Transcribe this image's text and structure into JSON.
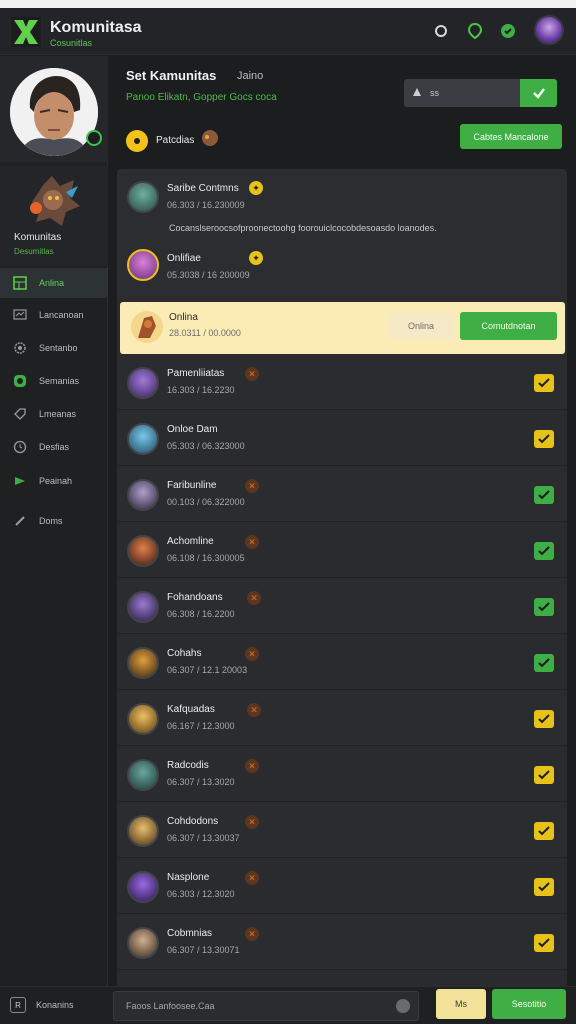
{
  "app": {
    "name": "Komunitasa",
    "subtitle": "Cosunitlas"
  },
  "community": {
    "name": "Komunitas",
    "subtitle": "Desumitlas"
  },
  "sidebar": {
    "items": [
      {
        "label": "Anlina",
        "icon": "grid-icon",
        "active": true
      },
      {
        "label": "Lancanoan",
        "icon": "monitor-icon",
        "active": false
      },
      {
        "label": "Sentanbo",
        "icon": "gear-icon",
        "active": false
      },
      {
        "label": "Semanias",
        "icon": "discord-icon",
        "active": false
      },
      {
        "label": "Lmeanas",
        "icon": "tag-icon",
        "active": false
      },
      {
        "label": "Desfias",
        "icon": "clock-icon",
        "active": false
      },
      {
        "label": "Peainah",
        "icon": "play-icon",
        "active": false
      },
      {
        "label": "Doms",
        "icon": "pencil-icon",
        "active": false
      }
    ]
  },
  "header": {
    "title": "Set Kamunitas",
    "tag": "Jaino",
    "subtitle": "Panoo Elikatn, Gopper Gocs coca",
    "search_placeholder": "ss",
    "filter_label": "Patcdias",
    "manage_label": "Cabtes Mancalone"
  },
  "panel": {
    "pinned": [
      {
        "name": "Saribe Contmns",
        "time": "06.303 / 16.230009"
      },
      {
        "name": "Onlifiae",
        "time": "05.3038 / 16 200009"
      }
    ],
    "description": "Cocanslseroocsofproonectoohg foorouiclcocobdesoasdo loanodes."
  },
  "highlight": {
    "name": "Onlina",
    "time": "28.0311 / 00.0000",
    "online_label": "Onlina",
    "button_label": "Comutdnotan"
  },
  "members": [
    {
      "name": "Pamenliiatas",
      "time": "16.303 / 16.2230"
    },
    {
      "name": "Onloe Dam",
      "time": "05.303 / 06.323000"
    },
    {
      "name": "Faribunline",
      "time": "00.103 / 06.322000"
    },
    {
      "name": "Achomline",
      "time": "06.108 / 16.300005"
    },
    {
      "name": "Fohandoans",
      "time": "06.308 / 16.2200"
    },
    {
      "name": "Cohahs",
      "time": "06.307 / 12.1 20003"
    },
    {
      "name": "Kafquadas",
      "time": "06.167 / 12.3000"
    },
    {
      "name": "Radcodis",
      "time": "06.307 / 13.3020"
    },
    {
      "name": "Cohdodons",
      "time": "06.307 / 13.30037"
    },
    {
      "name": "Nasplone",
      "time": "06.303 / 12.3020"
    },
    {
      "name": "Cobmnias",
      "time": "06.307 / 13.30071"
    }
  ],
  "footer": {
    "left_label": "Konanins",
    "input_placeholder": "Faoos Lanfoosee.Caa",
    "button1": "Ms",
    "button2": "Sesotitio"
  },
  "colors": {
    "accent_green": "#3fae45",
    "accent_yellow": "#e7c21a",
    "highlight_bg": "#fbecb6"
  }
}
